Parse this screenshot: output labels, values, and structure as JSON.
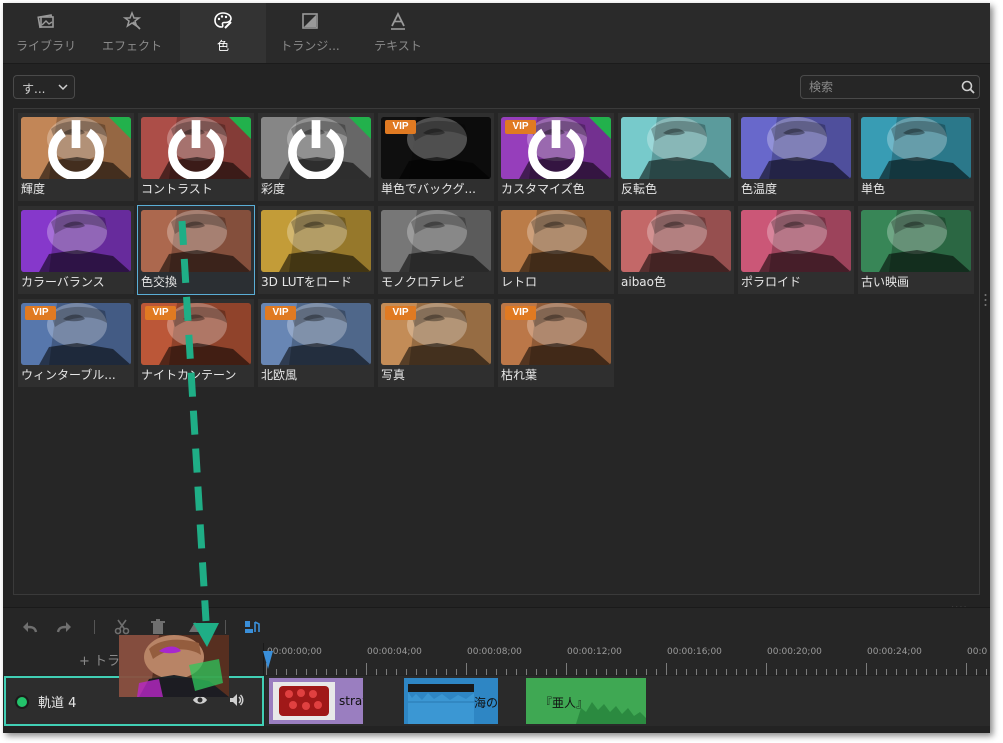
{
  "tabs": [
    {
      "label": "ライブラリ",
      "icon": "image-library-icon"
    },
    {
      "label": "エフェクト",
      "icon": "magic-wand-icon"
    },
    {
      "label": "色",
      "icon": "palette-icon",
      "active": true
    },
    {
      "label": "トランジ...",
      "icon": "transition-icon"
    },
    {
      "label": "テキスト",
      "icon": "text-icon"
    }
  ],
  "filter": {
    "selected": "す..."
  },
  "search": {
    "placeholder": "検索"
  },
  "effects": [
    {
      "name": "輝度",
      "badge": "free",
      "tint": "#c78a5a"
    },
    {
      "name": "コントラスト",
      "badge": "free",
      "tint": "#b0504a"
    },
    {
      "name": "彩度",
      "badge": "free",
      "tint": "#8a8a8a"
    },
    {
      "name": "単色でバックグ...",
      "badge": "VIP",
      "tint": "#101010"
    },
    {
      "name": "カスタマイズ色",
      "badge": "VIP",
      "tint": "#9a40c0"
    },
    {
      "name": "反転色",
      "badge": "none",
      "tint": "#7acfd0"
    },
    {
      "name": "色温度",
      "badge": "none",
      "tint": "#6a6ad0"
    },
    {
      "name": "単色",
      "badge": "none",
      "tint": "#3aa0b8"
    },
    {
      "name": "カラーバランス",
      "badge": "none",
      "tint": "#8a3ad0"
    },
    {
      "name": "色交換",
      "badge": "none",
      "tint": "#b06a50",
      "selected": true
    },
    {
      "name": "3D LUTをロード",
      "badge": "none",
      "tint": "#c8a03a"
    },
    {
      "name": "モノクロテレビ",
      "badge": "none",
      "tint": "#7a7a7a"
    },
    {
      "name": "レトロ",
      "badge": "none",
      "tint": "#c0804a"
    },
    {
      "name": "aibao色",
      "badge": "none",
      "tint": "#c86a6a"
    },
    {
      "name": "ポラロイド",
      "badge": "none",
      "tint": "#d05a7a"
    },
    {
      "name": "古い映画",
      "badge": "none",
      "tint": "#3a8a5a"
    },
    {
      "name": "ウィンターブル...",
      "badge": "VIP",
      "tint": "#5a7ab0"
    },
    {
      "name": "ナイトカンテーン",
      "badge": "VIP",
      "tint": "#c05a3a"
    },
    {
      "name": "北欧風",
      "badge": "VIP",
      "tint": "#6a8ab8"
    },
    {
      "name": "写真",
      "badge": "VIP",
      "tint": "#c8905a"
    },
    {
      "name": "枯れ葉",
      "badge": "VIP",
      "tint": "#c07a4a"
    }
  ],
  "vip_label": "VIP",
  "timeline": {
    "add_track_label": "トラ",
    "ruler_labels": [
      "00:00:00;00",
      "00:00:04;00",
      "00:00:08;00",
      "00:00:12;00",
      "00:00:16;00",
      "00:00:20;00",
      "00:00:24;00",
      "00:0"
    ],
    "track_name": "軌道 4",
    "clips": [
      {
        "label": "strav",
        "color": "#9a7ec0"
      },
      {
        "label": "海の",
        "color": "#2e86c4"
      },
      {
        "label": "『亜人』",
        "color": "#3fa853"
      }
    ]
  },
  "colors": {
    "accent": "#41cfb5",
    "vip": "#e07a22",
    "free_badge": "#22b14c",
    "selection": "#5aaed6"
  }
}
